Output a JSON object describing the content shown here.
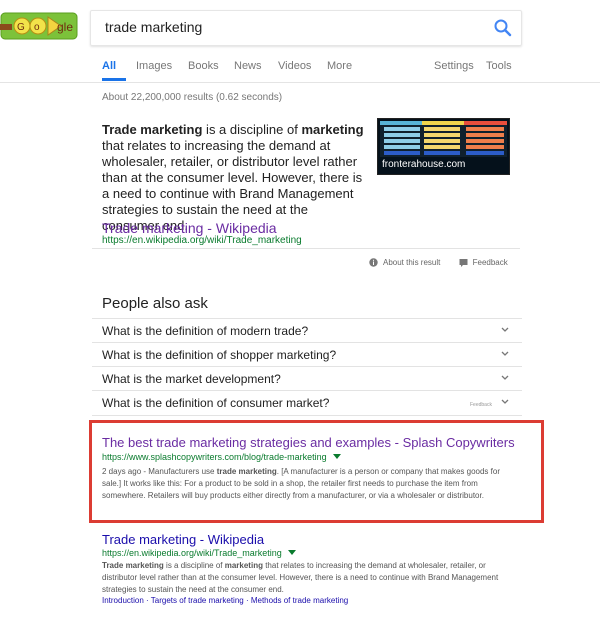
{
  "header": {
    "logo_text": "Google",
    "search_query": "trade marketing",
    "search_placeholder": ""
  },
  "tabs": {
    "all": "All",
    "images": "Images",
    "books": "Books",
    "news": "News",
    "videos": "Videos",
    "more": "More",
    "settings": "Settings",
    "tools": "Tools"
  },
  "stats": {
    "text": "About 22,200,000 results (0.62 seconds)"
  },
  "featured": {
    "text_before_1": "Trade marketing",
    "text_mid_1": " is a discipline of ",
    "text_bold_2": "marketing",
    "text_after": " that relates to increasing the demand at wholesaler, retailer, or distributor level rather than at the consumer level. However, there is a need to continue with Brand Management strategies to sustain the need at the consumer end.",
    "thumb_caption": "fronterahouse.com",
    "link_title": "Trade marketing - Wikipedia",
    "link_url": "https://en.wikipedia.org/wiki/Trade_marketing"
  },
  "about": {
    "about_label": "About this result",
    "feedback_label": "Feedback"
  },
  "people_also_ask": {
    "title": "People also ask",
    "questions": [
      "What is the definition of modern trade?",
      "What is the definition of shopper marketing?",
      "What is the market development?",
      "What is the definition of consumer market?"
    ],
    "feedback_tiny": "Feedback"
  },
  "result1": {
    "title": "The best trade marketing strategies and examples - Splash Copywriters",
    "url": "https://www.splashcopywriters.com/blog/trade-marketing",
    "snippet_prefix": "2 days ago - Manufacturers use ",
    "snippet_bold": "trade marketing",
    "snippet_suffix": ". [A manufacturer is a person or company that makes goods for sale.] It works like this: For a product to be sold in a shop, the retailer first needs to purchase the item from somewhere. Retailers will buy products either directly from a manufacturer, or via a wholesaler or distributor."
  },
  "result2": {
    "title": "Trade marketing - Wikipedia",
    "url": "https://en.wikipedia.org/wiki/Trade_marketing",
    "snippet_b1": "Trade marketing",
    "snippet_m1": " is a discipline of ",
    "snippet_b2": "marketing",
    "snippet_rest": " that relates to increasing the demand at wholesaler, retailer, or distributor level rather than at the consumer level. However, there is a need to continue with Brand Management strategies to sustain the need at the consumer end.",
    "links": [
      "Introduction",
      "Targets of trade marketing",
      "Methods of trade marketing"
    ]
  },
  "icons": {
    "search": "search-icon",
    "info": "info-icon",
    "feedback": "feedback-icon",
    "chevron": "chevron-down-icon",
    "dropdown": "caret-down-icon"
  },
  "colors": {
    "accent": "#1a73e8",
    "visited": "#6a2ca2",
    "link": "#1a0dab",
    "url": "#0a7b2e",
    "highlight": "#dc3c33"
  }
}
